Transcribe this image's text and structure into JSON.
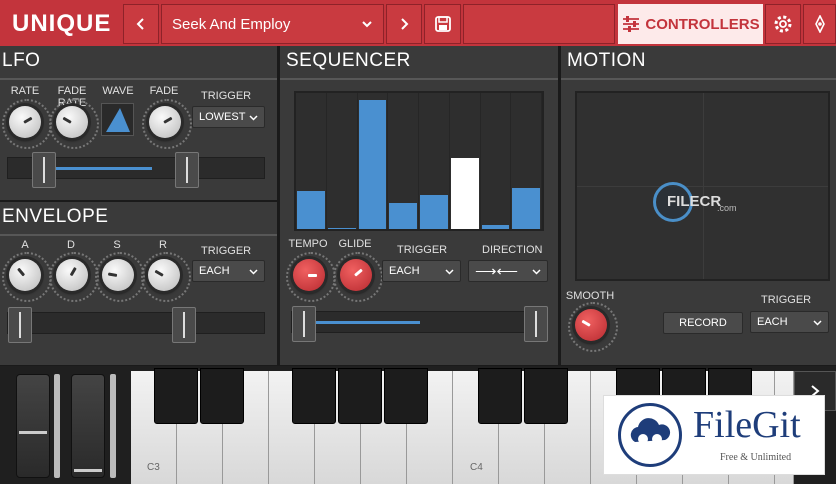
{
  "header": {
    "logo": "UNIQUE",
    "preset_name": "Seek And Employ",
    "controllers_label": "CONTROLLERS"
  },
  "icons": {
    "prev": "chevron-left-icon",
    "next": "chevron-right-icon",
    "save": "save-icon",
    "dropdown": "chevron-down-icon",
    "controllers": "sliders-icon",
    "settings": "gear-icon",
    "navigate": "navigation-icon",
    "expand": "chevron-right-icon"
  },
  "lfo": {
    "title": "LFO",
    "rate_label": "RATE",
    "fade_rate_label": "FADE RATE",
    "wave_label": "WAVE",
    "fade_label": "FADE",
    "trigger_label": "TRIGGER",
    "trigger_value": "LOWEST"
  },
  "envelope": {
    "title": "ENVELOPE",
    "a_label": "A",
    "d_label": "D",
    "s_label": "S",
    "r_label": "R",
    "trigger_label": "TRIGGER",
    "trigger_value": "EACH"
  },
  "sequencer": {
    "title": "SEQUENCER",
    "tempo_label": "TEMPO",
    "glide_label": "GLIDE",
    "trigger_label": "TRIGGER",
    "trigger_value": "EACH",
    "direction_label": "DIRECTION",
    "direction_value": "⟶⟵",
    "steps": [
      0.28,
      0.0,
      0.95,
      0.19,
      0.25,
      0.52,
      0.03,
      0.3
    ],
    "active_step": 5
  },
  "motion": {
    "title": "MOTION",
    "smooth_label": "SMOOTH",
    "record_label": "RECORD",
    "trigger_label": "TRIGGER",
    "trigger_value": "EACH"
  },
  "keyboard": {
    "c3_label": "C3",
    "c4_label": "C4"
  },
  "watermark": {
    "filecr_text": "FILECR",
    "filecr_domain": ".com",
    "filegit_name": "FileGit",
    "filegit_tagline": "Free & Unlimited"
  },
  "colors": {
    "accent": "#c3343c",
    "step_blue": "#4a90d0",
    "step_active": "#ffffff"
  }
}
